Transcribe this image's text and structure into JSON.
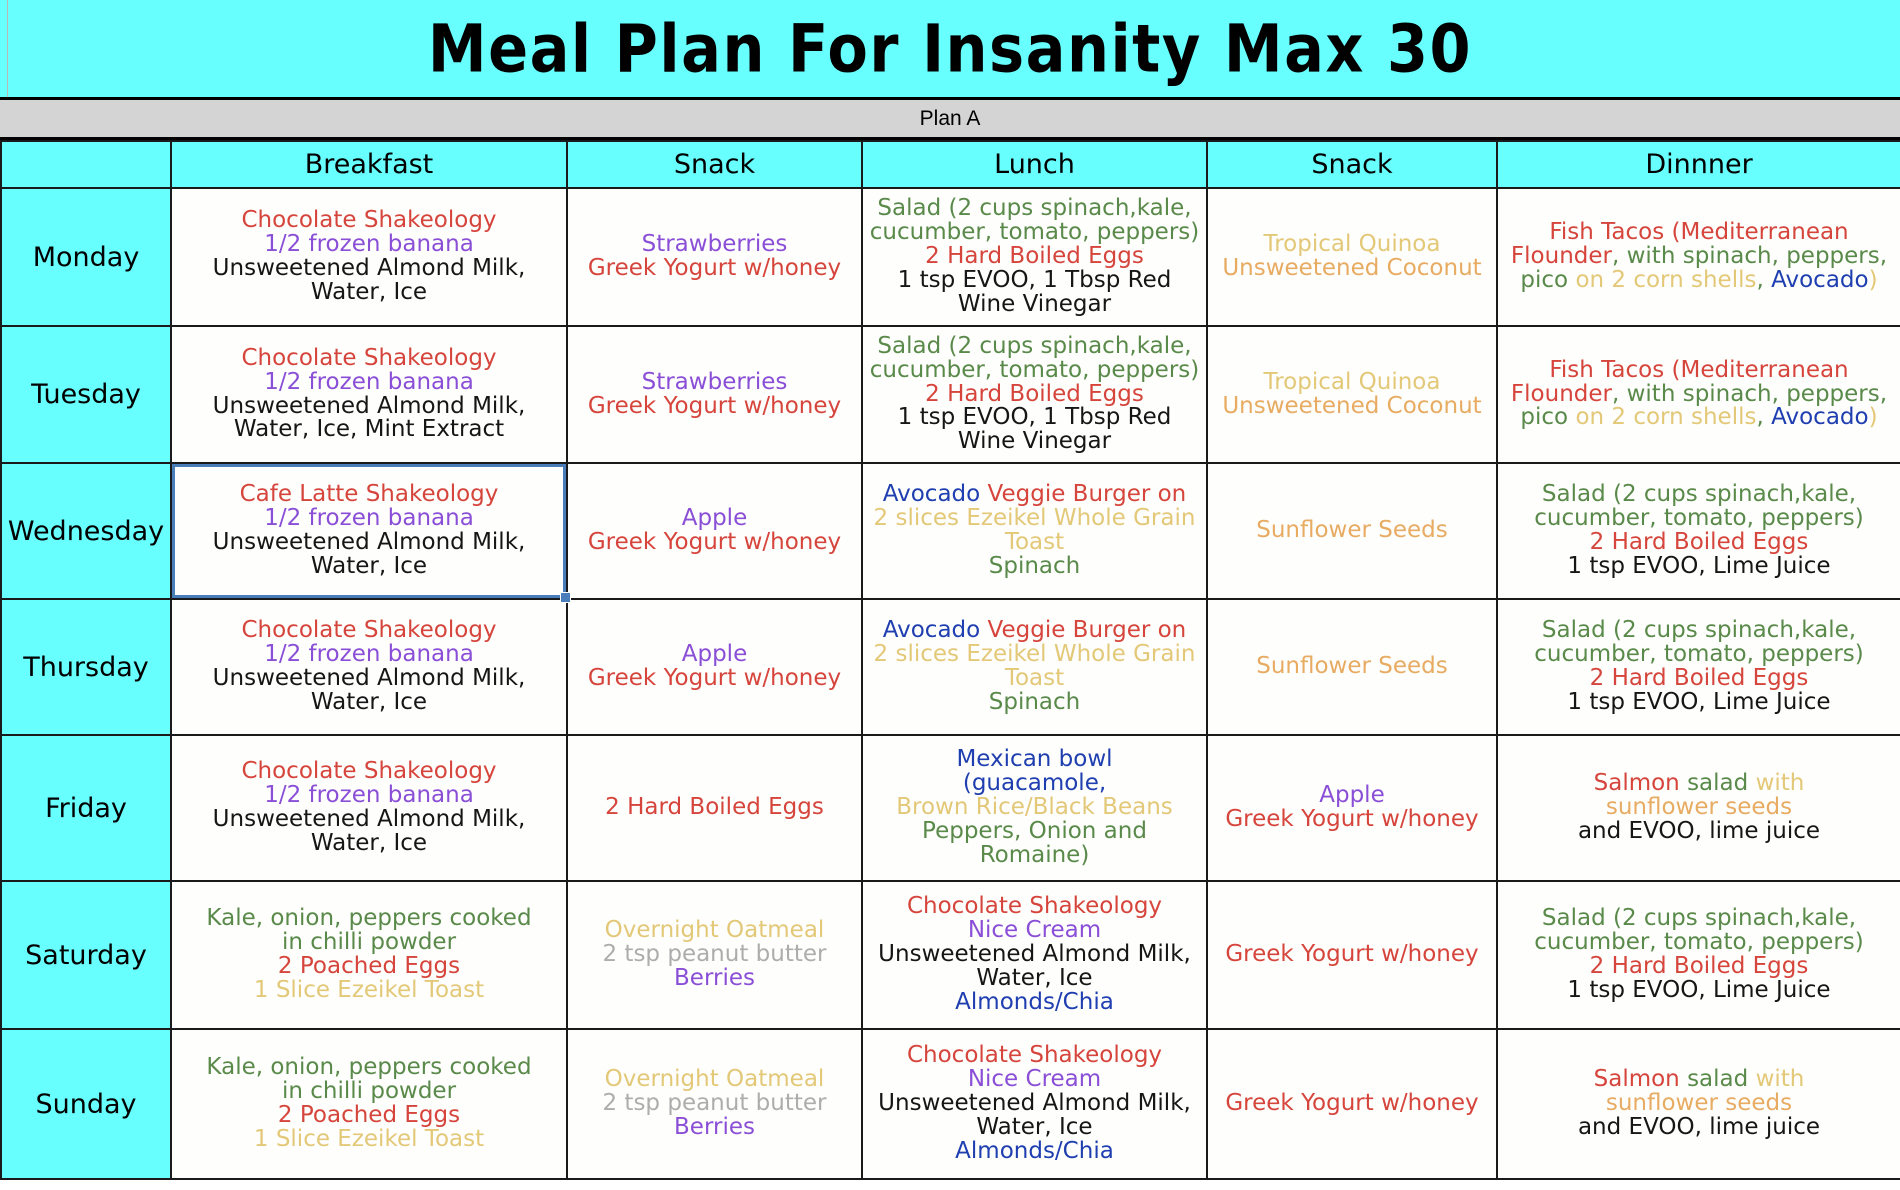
{
  "title": "Meal Plan For Insanity Max 30",
  "plan_label": "Plan A",
  "colors": {
    "header_cyan": "#68FFFF",
    "plan_gray": "#d4d4d4",
    "selection_blue": "#4a7ebb",
    "red": "#d6453c",
    "purple": "#8a4fd6",
    "green": "#5a8a4a",
    "tan": "#e3c878",
    "orange_tan": "#e8ab62",
    "blue": "#1f3fb0",
    "gray": "#adadad",
    "black": "#161616"
  },
  "columns": [
    "",
    "Breakfast",
    "Snack",
    "Lunch",
    "Snack",
    "Dinnner"
  ],
  "selected_cell": "wednesday-breakfast",
  "days": [
    "Monday",
    "Tuesday",
    "Wednesday",
    "Thursday",
    "Friday",
    "Saturday",
    "Sunday"
  ],
  "rows": {
    "monday": {
      "day": "Monday",
      "breakfast": [
        {
          "text": "Chocolate Shakeology",
          "color": "red"
        },
        {
          "text": "1/2 frozen banana",
          "color": "purple"
        },
        {
          "text": "Unsweetened Almond Milk,",
          "color": "black"
        },
        {
          "text": "Water, Ice",
          "color": "black"
        }
      ],
      "snack1": [
        {
          "text": "Strawberries",
          "color": "purple"
        },
        {
          "text": "Greek Yogurt w/honey",
          "color": "red"
        }
      ],
      "lunch": [
        {
          "text": "Salad (2 cups spinach,kale,",
          "color": "green"
        },
        {
          "text": "cucumber, tomato, peppers)",
          "color": "green"
        },
        {
          "text": "2 Hard Boiled Eggs",
          "color": "red"
        },
        {
          "text": "1 tsp EVOO, 1 Tbsp Red",
          "color": "black"
        },
        {
          "text": "Wine Vinegar",
          "color": "black"
        }
      ],
      "snack2": [
        {
          "text": "Tropical Quinoa",
          "color": "tan"
        },
        {
          "text": "Unsweetened Coconut",
          "color": "orange_tan"
        }
      ],
      "dinner": [
        [
          {
            "text": "Fish Tacos (Mediterranean",
            "color": "red"
          }
        ],
        [
          {
            "text": "Flounder",
            "color": "red"
          },
          {
            "text": ", with spinach, peppers,",
            "color": "green"
          }
        ],
        [
          {
            "text": "pico ",
            "color": "green"
          },
          {
            "text": "on 2 corn shells",
            "color": "tan"
          },
          {
            "text": ", ",
            "color": "green"
          },
          {
            "text": "Avocado",
            "color": "blue"
          },
          {
            "text": ")",
            "color": "tan"
          }
        ]
      ]
    },
    "tuesday": {
      "day": "Tuesday",
      "breakfast": [
        {
          "text": "Chocolate Shakeology",
          "color": "red"
        },
        {
          "text": "1/2 frozen banana",
          "color": "purple"
        },
        {
          "text": "Unsweetened Almond Milk,",
          "color": "black"
        },
        {
          "text": "Water, Ice, Mint Extract",
          "color": "black"
        }
      ],
      "snack1": [
        {
          "text": "Strawberries",
          "color": "purple"
        },
        {
          "text": "Greek Yogurt w/honey",
          "color": "red"
        }
      ],
      "lunch": [
        {
          "text": "Salad (2 cups spinach,kale,",
          "color": "green"
        },
        {
          "text": "cucumber, tomato, peppers)",
          "color": "green"
        },
        {
          "text": "2 Hard Boiled Eggs",
          "color": "red"
        },
        {
          "text": "1 tsp EVOO, 1 Tbsp Red",
          "color": "black"
        },
        {
          "text": "Wine Vinegar",
          "color": "black"
        }
      ],
      "snack2": [
        {
          "text": "Tropical Quinoa",
          "color": "tan"
        },
        {
          "text": "Unsweetened Coconut",
          "color": "orange_tan"
        }
      ],
      "dinner": [
        [
          {
            "text": "Fish Tacos (Mediterranean",
            "color": "red"
          }
        ],
        [
          {
            "text": "Flounder",
            "color": "red"
          },
          {
            "text": ", with spinach, peppers,",
            "color": "green"
          }
        ],
        [
          {
            "text": "pico ",
            "color": "green"
          },
          {
            "text": "on 2 corn shells",
            "color": "tan"
          },
          {
            "text": ", ",
            "color": "green"
          },
          {
            "text": "Avocado",
            "color": "blue"
          },
          {
            "text": ")",
            "color": "tan"
          }
        ]
      ]
    },
    "wednesday": {
      "day": "Wednesday",
      "breakfast": [
        {
          "text": "Cafe Latte Shakeology",
          "color": "red"
        },
        {
          "text": "1/2 frozen banana",
          "color": "purple"
        },
        {
          "text": "Unsweetened Almond Milk,",
          "color": "black"
        },
        {
          "text": "Water, Ice",
          "color": "black"
        }
      ],
      "snack1": [
        {
          "text": "Apple",
          "color": "purple"
        },
        {
          "text": "Greek Yogurt w/honey",
          "color": "red"
        }
      ],
      "lunch": [
        [
          {
            "text": "Avocado ",
            "color": "blue"
          },
          {
            "text": "Veggie Burger on",
            "color": "red"
          }
        ],
        [
          {
            "text": "2 slices Ezeikel Whole Grain",
            "color": "tan"
          }
        ],
        [
          {
            "text": "Toast",
            "color": "tan"
          }
        ],
        [
          {
            "text": "Spinach",
            "color": "green"
          }
        ]
      ],
      "snack2": [
        {
          "text": "Sunflower Seeds",
          "color": "orange_tan"
        }
      ],
      "dinner": [
        {
          "text": "Salad (2 cups spinach,kale,",
          "color": "green"
        },
        {
          "text": "cucumber, tomato, peppers)",
          "color": "green"
        },
        {
          "text": "2 Hard Boiled Eggs",
          "color": "red"
        },
        {
          "text": "1 tsp EVOO, Lime Juice",
          "color": "black"
        }
      ]
    },
    "thursday": {
      "day": "Thursday",
      "breakfast": [
        {
          "text": "Chocolate Shakeology",
          "color": "red"
        },
        {
          "text": "1/2 frozen banana",
          "color": "purple"
        },
        {
          "text": "Unsweetened Almond Milk,",
          "color": "black"
        },
        {
          "text": "Water, Ice",
          "color": "black"
        }
      ],
      "snack1": [
        {
          "text": "Apple",
          "color": "purple"
        },
        {
          "text": "Greek Yogurt w/honey",
          "color": "red"
        }
      ],
      "lunch": [
        [
          {
            "text": "Avocado ",
            "color": "blue"
          },
          {
            "text": "Veggie Burger on",
            "color": "red"
          }
        ],
        [
          {
            "text": "2 slices Ezeikel Whole Grain",
            "color": "tan"
          }
        ],
        [
          {
            "text": "Toast",
            "color": "tan"
          }
        ],
        [
          {
            "text": "Spinach",
            "color": "green"
          }
        ]
      ],
      "snack2": [
        {
          "text": "Sunflower Seeds",
          "color": "orange_tan"
        }
      ],
      "dinner": [
        {
          "text": "Salad (2 cups spinach,kale,",
          "color": "green"
        },
        {
          "text": "cucumber, tomato, peppers)",
          "color": "green"
        },
        {
          "text": "2 Hard Boiled Eggs",
          "color": "red"
        },
        {
          "text": "1 tsp EVOO, Lime Juice",
          "color": "black"
        }
      ]
    },
    "friday": {
      "day": "Friday",
      "breakfast": [
        {
          "text": "Chocolate Shakeology",
          "color": "red"
        },
        {
          "text": "1/2 frozen banana",
          "color": "purple"
        },
        {
          "text": "Unsweetened Almond Milk,",
          "color": "black"
        },
        {
          "text": "Water, Ice",
          "color": "black"
        }
      ],
      "snack1": [
        {
          "text": "2 Hard Boiled Eggs",
          "color": "red"
        }
      ],
      "lunch": [
        [
          {
            "text": "Mexican bowl",
            "color": "blue"
          }
        ],
        [
          {
            "text": "(guacamole,",
            "color": "blue"
          }
        ],
        [
          {
            "text": "Brown Rice/Black Beans",
            "color": "tan"
          }
        ],
        [
          {
            "text": "Peppers, Onion and",
            "color": "green"
          }
        ],
        [
          {
            "text": "Romaine)",
            "color": "green"
          }
        ]
      ],
      "snack2": [
        {
          "text": "Apple",
          "color": "purple"
        },
        {
          "text": "Greek Yogurt w/honey",
          "color": "red"
        }
      ],
      "dinner": [
        [
          {
            "text": "Salmon ",
            "color": "red"
          },
          {
            "text": "salad ",
            "color": "green"
          },
          {
            "text": "with",
            "color": "tan"
          }
        ],
        [
          {
            "text": "sunflower seeds",
            "color": "orange_tan"
          }
        ],
        [
          {
            "text": "and EVOO, lime juice",
            "color": "black"
          }
        ]
      ]
    },
    "saturday": {
      "day": "Saturday",
      "breakfast": [
        {
          "text": "Kale, onion, peppers cooked",
          "color": "green"
        },
        {
          "text": "in chilli powder",
          "color": "green"
        },
        {
          "text": "2 Poached Eggs",
          "color": "red"
        },
        {
          "text": "1 Slice Ezeikel Toast",
          "color": "tan"
        }
      ],
      "snack1": [
        {
          "text": "Overnight Oatmeal",
          "color": "tan"
        },
        {
          "text": "2 tsp peanut butter",
          "color": "gray"
        },
        {
          "text": "Berries",
          "color": "purple"
        }
      ],
      "lunch": [
        {
          "text": "Chocolate Shakeology",
          "color": "red"
        },
        {
          "text": "Nice Cream",
          "color": "purple"
        },
        {
          "text": "Unsweetened Almond Milk,",
          "color": "black"
        },
        {
          "text": "Water, Ice",
          "color": "black"
        },
        {
          "text": "Almonds/Chia",
          "color": "blue"
        }
      ],
      "snack2": [
        {
          "text": "Greek Yogurt w/honey",
          "color": "red"
        }
      ],
      "dinner": [
        {
          "text": "Salad (2 cups spinach,kale,",
          "color": "green"
        },
        {
          "text": "cucumber, tomato, peppers)",
          "color": "green"
        },
        {
          "text": "2 Hard Boiled Eggs",
          "color": "red"
        },
        {
          "text": "1 tsp EVOO, Lime Juice",
          "color": "black"
        }
      ]
    },
    "sunday": {
      "day": "Sunday",
      "breakfast": [
        {
          "text": "Kale, onion, peppers cooked",
          "color": "green"
        },
        {
          "text": "in chilli powder",
          "color": "green"
        },
        {
          "text": "2 Poached Eggs",
          "color": "red"
        },
        {
          "text": "1 Slice Ezeikel Toast",
          "color": "tan"
        }
      ],
      "snack1": [
        {
          "text": "Overnight Oatmeal",
          "color": "tan"
        },
        {
          "text": "2 tsp peanut butter",
          "color": "gray"
        },
        {
          "text": "Berries",
          "color": "purple"
        }
      ],
      "lunch": [
        {
          "text": "Chocolate Shakeology",
          "color": "red"
        },
        {
          "text": "Nice Cream",
          "color": "purple"
        },
        {
          "text": "Unsweetened Almond Milk,",
          "color": "black"
        },
        {
          "text": "Water, Ice",
          "color": "black"
        },
        {
          "text": "Almonds/Chia",
          "color": "blue"
        }
      ],
      "snack2": [
        {
          "text": "Greek Yogurt w/honey",
          "color": "red"
        }
      ],
      "dinner": [
        [
          {
            "text": "Salmon ",
            "color": "red"
          },
          {
            "text": "salad ",
            "color": "green"
          },
          {
            "text": "with",
            "color": "tan"
          }
        ],
        [
          {
            "text": "sunflower seeds",
            "color": "orange_tan"
          }
        ],
        [
          {
            "text": "and EVOO, lime juice",
            "color": "black"
          }
        ]
      ]
    }
  }
}
